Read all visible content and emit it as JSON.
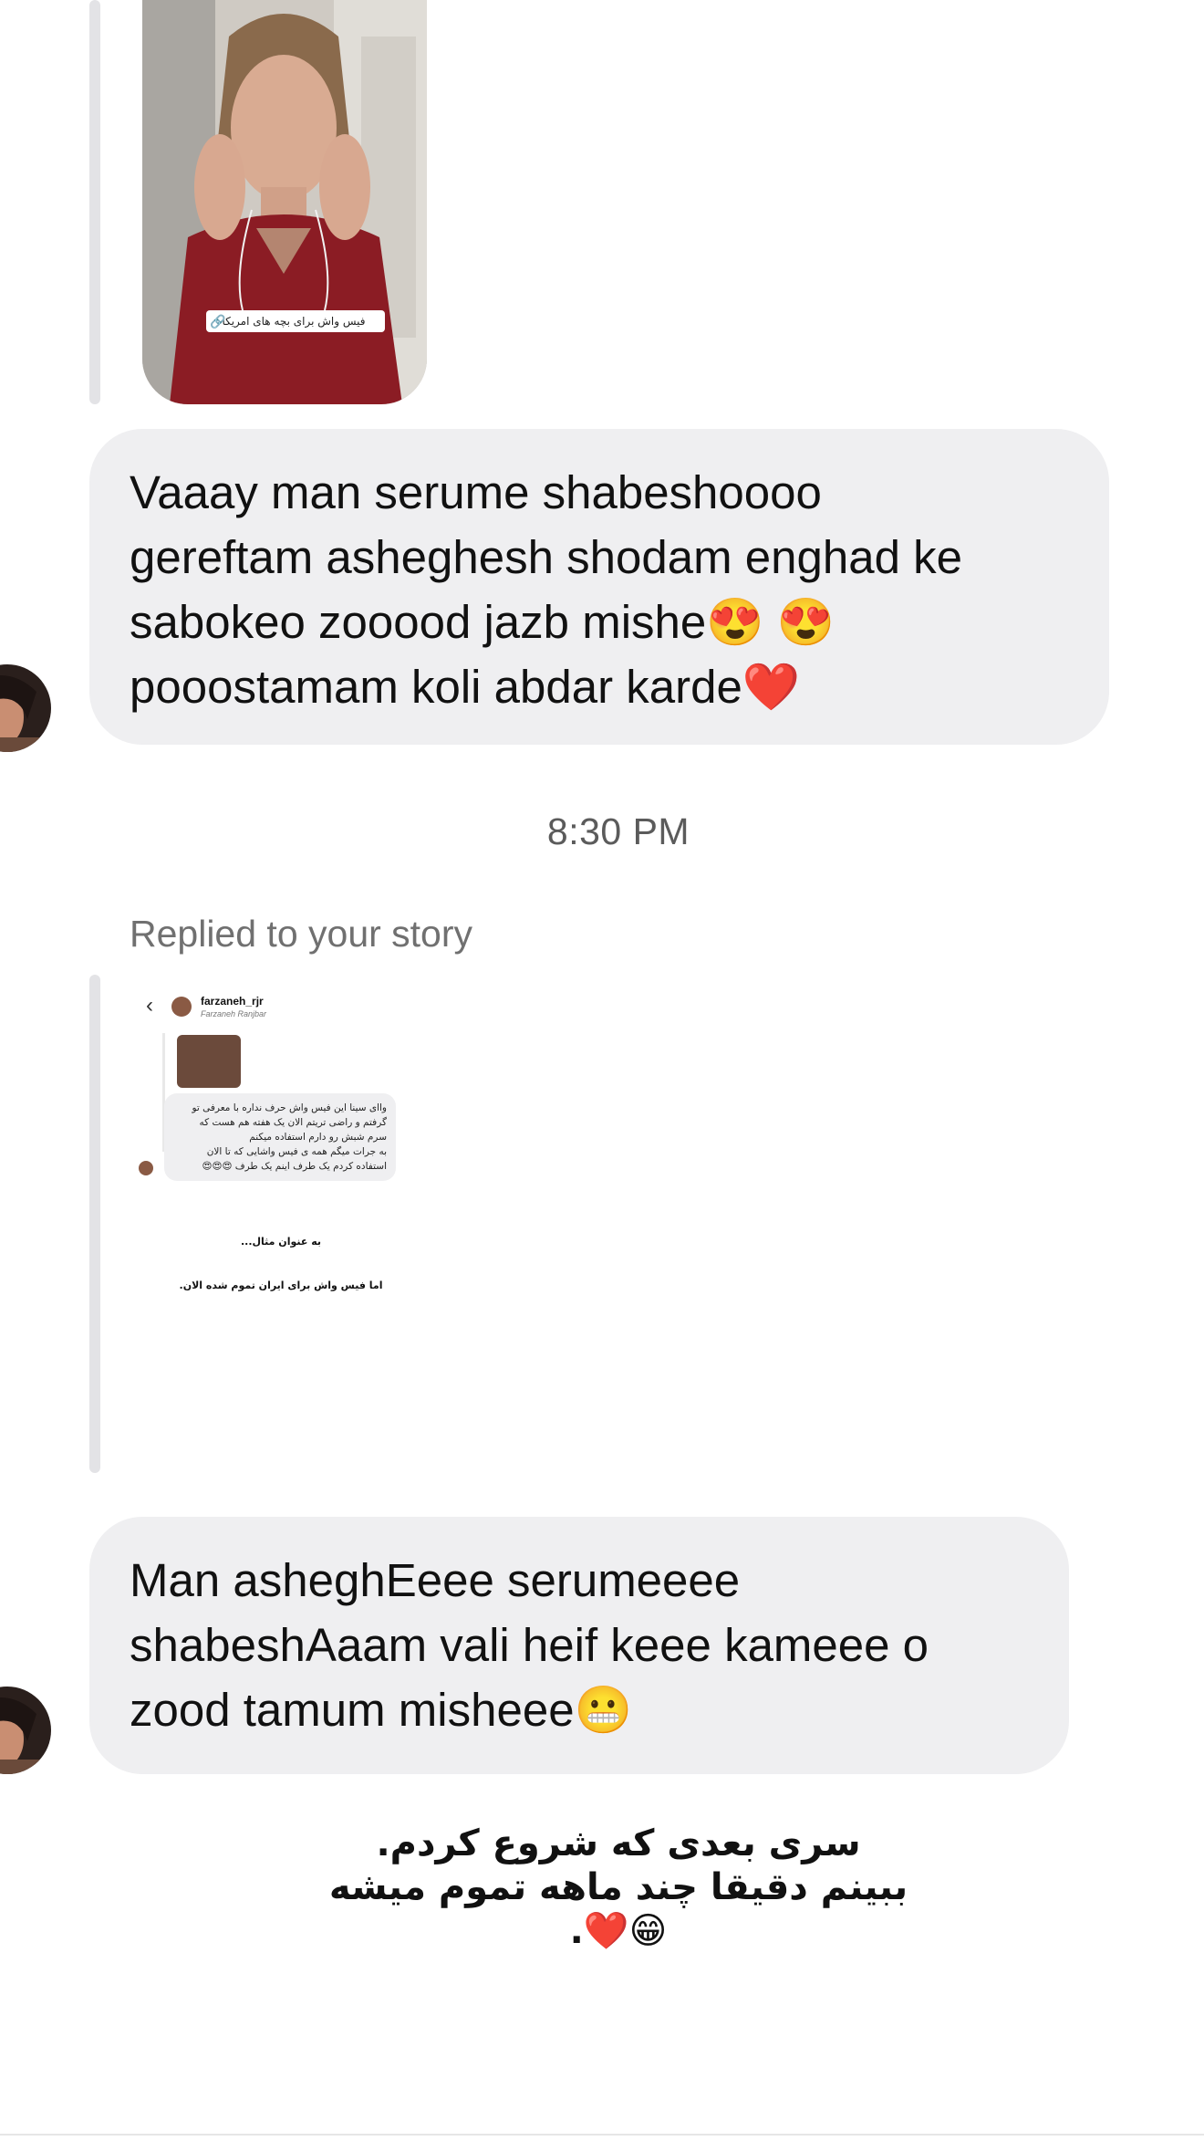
{
  "story1": {
    "overlay_label": "فیس واش برای بچه های امریکا"
  },
  "message1": {
    "lines": [
      "Vaaay man serume shabeshoooo",
      "gereftam asheghesh shodam enghad ke",
      "sabokeo zooood jazb mishe😍 😍",
      "pooostamam koli abdar karde❤️"
    ]
  },
  "timestamp": "8:30 PM",
  "reply_header": "Replied to your story",
  "story2": {
    "username": "farzaneh_rjr",
    "fullname": "Farzaneh Ranjbar",
    "bubble_lines": [
      "واای سینا این فیس واش حرف نداره با معرفی تو",
      "گرفتم و راضی تریتم الان یک هفته هم هست که",
      "سرم شبش رو دارم استفاده میکنم",
      "به جرات میگم همه ی فیس واشایی که تا الان",
      "استفاده کردم یک طرف اینم یک طرف 😍😍😍"
    ],
    "caption_example": "به عنوان مثال...",
    "caption_finished": "اما فیس واش برای ایران تموم شده الان."
  },
  "message2": {
    "lines": [
      "Man asheghEeee serumeeee",
      "shabeshAaam vali heif keee kameee o",
      "zood tamum misheee😬"
    ]
  },
  "caption": {
    "lines": [
      "سری بعدی که شروع کردم.",
      "ببینم دقیقا چند ماهه تموم میشه",
      "😁❤️."
    ]
  }
}
